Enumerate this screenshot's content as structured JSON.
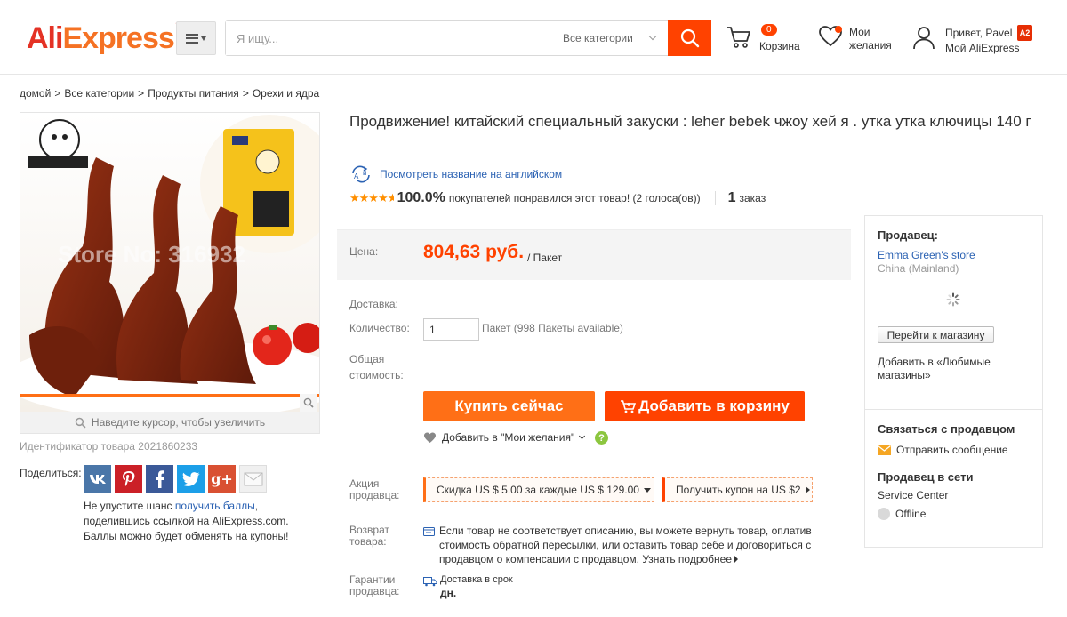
{
  "header": {
    "logo_ali": "Ali",
    "logo_express": "Express",
    "logo_tm": "™",
    "search_placeholder": "Я ищу...",
    "category_select": "Все категории",
    "cart_count": "0",
    "cart_label": "Корзина",
    "wishlist_line1": "Мои",
    "wishlist_line2": "желания",
    "greeting": "Привет, Pavel",
    "user_badge": "A2",
    "my_aliexpress": "Мой AliExpress",
    "accent_color": "#ff4200"
  },
  "breadcrumb": [
    "домой",
    "Все категории",
    "Продукты питания",
    "Орехи и ядра"
  ],
  "gallery": {
    "watermark": "Store No: 316932",
    "zoom_hint": "Наведите курсор, чтобы увеличить",
    "product_id": "Идентификатор товара 2021860233"
  },
  "share": {
    "label": "Поделиться:",
    "networks": [
      "vk",
      "pinterest",
      "facebook",
      "twitter",
      "google-plus",
      "email"
    ],
    "text_before": "Не упустите шанс ",
    "link": "получить баллы",
    "text_after": ", поделившись ссылкой на AliExpress.com. Баллы можно будет обменять на купоны!"
  },
  "product": {
    "title": "Продвижение! китайский специальный закуски : leher bebek чжоу хей я . утка утка ключицы 140 г",
    "translate_link": "Посмотреть название на английском",
    "rating_stars": 4.5,
    "rating_pct": "100.0%",
    "rating_text": "покупателей понравился этот товар! (2 голоса(ов))",
    "orders_count": "1",
    "orders_label": "заказ",
    "price_label": "Цена:",
    "price": "804,63 руб.",
    "price_unit": "/ Пакет",
    "delivery_label": "Доставка:",
    "quantity_label": "Количество:",
    "quantity_value": "1",
    "quantity_available": "Пакет (998 Пакеты available)",
    "total_label": "Общая стоимость:",
    "buy_now": "Купить сейчас",
    "add_to_cart": "Добавить в корзину",
    "add_wishlist": "Добавить в \"Мои желания\"",
    "promo_label": "Акция продавца:",
    "coupon1": "Скидка US $ 5.00 за каждые US $ 129.00",
    "coupon2": "Получить купон на US $2",
    "return_label": "Возврат товара:",
    "return_text": "Если товар не соответствует описанию, вы можете вернуть товар, оплатив стоимость обратной пересылки, или оставить товар себе и договориться с продавцом о компенсации с продавцом.",
    "return_link": "Узнать подробнее",
    "guarantee_label": "Гарантии продавца:",
    "guarantee_text": "Доставка в срок",
    "guarantee_days": "дн."
  },
  "seller": {
    "heading": "Продавец:",
    "store_name": "Emma Green's store",
    "country": "China (Mainland)",
    "go_to_store": "Перейти к магазину",
    "add_favorite": "Добавить в «Любимые магазины»",
    "contact_heading": "Связаться с продавцом",
    "send_message": "Отправить сообщение",
    "online_heading": "Продавец в сети",
    "service_center": "Service Center",
    "status": "Offline"
  }
}
